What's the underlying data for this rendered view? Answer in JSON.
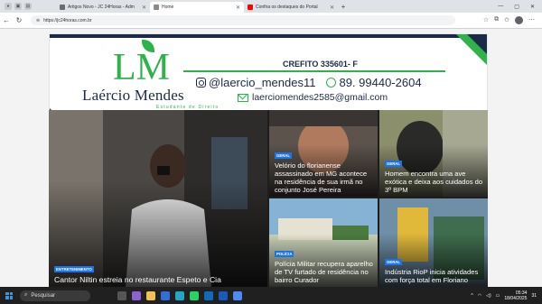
{
  "browser": {
    "tabs": [
      {
        "title": "Artigos Novo - JC 24Horas - Adm",
        "favicon_color": "#6d6d6d",
        "active": false
      },
      {
        "title": "Home",
        "favicon_color": "#8a8a8a",
        "active": true
      },
      {
        "title": "Confira os destaques do Portal",
        "favicon_color": "#ff0000",
        "active": false
      }
    ],
    "url": "https://jc24horas.com.br"
  },
  "banner": {
    "logo_initials_l": "L",
    "logo_initials_m": "M",
    "logo_name": "Laércio Mendes",
    "logo_subtitle": "Estudante de Direito",
    "credit": "CREFITO 335601- F",
    "instagram": "@laercio_mendes11",
    "phone": "89. 99440-2604",
    "email": "laerciomendes2585@gmail.com",
    "colors": {
      "navy": "#1b2a49",
      "green": "#2db34a"
    }
  },
  "news": {
    "main": {
      "category": "ENTRETENIMENTO",
      "headline": "Cantor Niltin estreia no restaurante Espeto e Cia"
    },
    "items": [
      {
        "category": "GERAL",
        "headline": "Velório do florianense assassinado em MG acontece na residência de sua irmã no conjunto José Pereira"
      },
      {
        "category": "GERAL",
        "headline": "Homem encontra uma ave exótica e deixa aos cuidados do 3º BPM"
      },
      {
        "category": "POLÍCIA",
        "headline": "Polícia Militar recupera aparelho de TV furtado de residência no bairro Curador"
      },
      {
        "category": "GERAL",
        "headline": "Indústria RioP inicia atividades com força total em Floriano"
      }
    ],
    "badge_color": "#1a73e8"
  },
  "taskbar": {
    "search_placeholder": "Pesquisar",
    "time": "05:34",
    "date": "18/04/2025",
    "notification_count": "31"
  }
}
